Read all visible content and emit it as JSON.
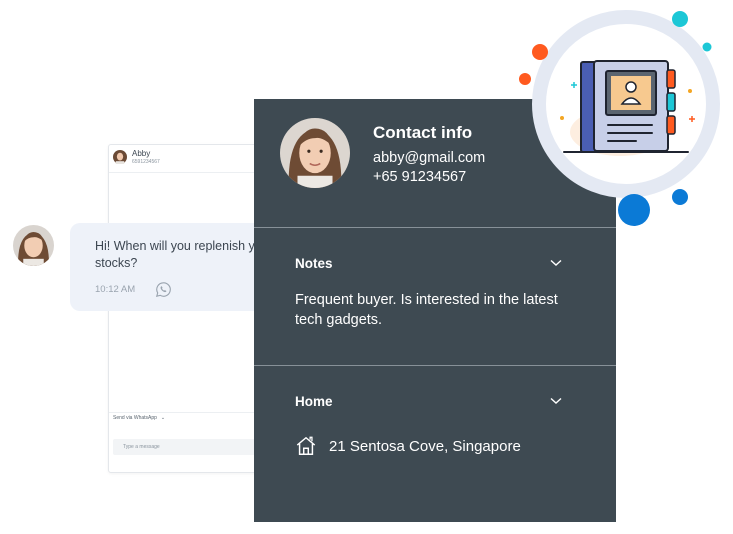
{
  "chat": {
    "contact_name": "Abby",
    "contact_phone": "6591234567",
    "send_via": "Send via WhatsApp",
    "compose_placeholder": "Type a message"
  },
  "message": {
    "text_line1": "Hi! When will you replenish yo",
    "text_line2": "stocks?",
    "time": "10:12 AM",
    "channel_icon": "whatsapp-icon"
  },
  "contact": {
    "title": "Contact info",
    "email": "abby@gmail.com",
    "phone": "+65 91234567"
  },
  "notes": {
    "title": "Notes",
    "text": "Frequent buyer. Is interested in the latest tech gadgets."
  },
  "home": {
    "title": "Home",
    "address": "21 Sentosa Cove, Singapore"
  },
  "colors": {
    "panel_bg": "#3e4a52",
    "bubble_bg": "#eef2f9",
    "accent_blue": "#0b7ad6",
    "accent_orange": "#ff5a1f",
    "accent_cyan": "#1cc7d6"
  },
  "icons": [
    "whatsapp-icon",
    "chevron-down-icon",
    "home-icon",
    "address-book-icon",
    "avatar"
  ]
}
